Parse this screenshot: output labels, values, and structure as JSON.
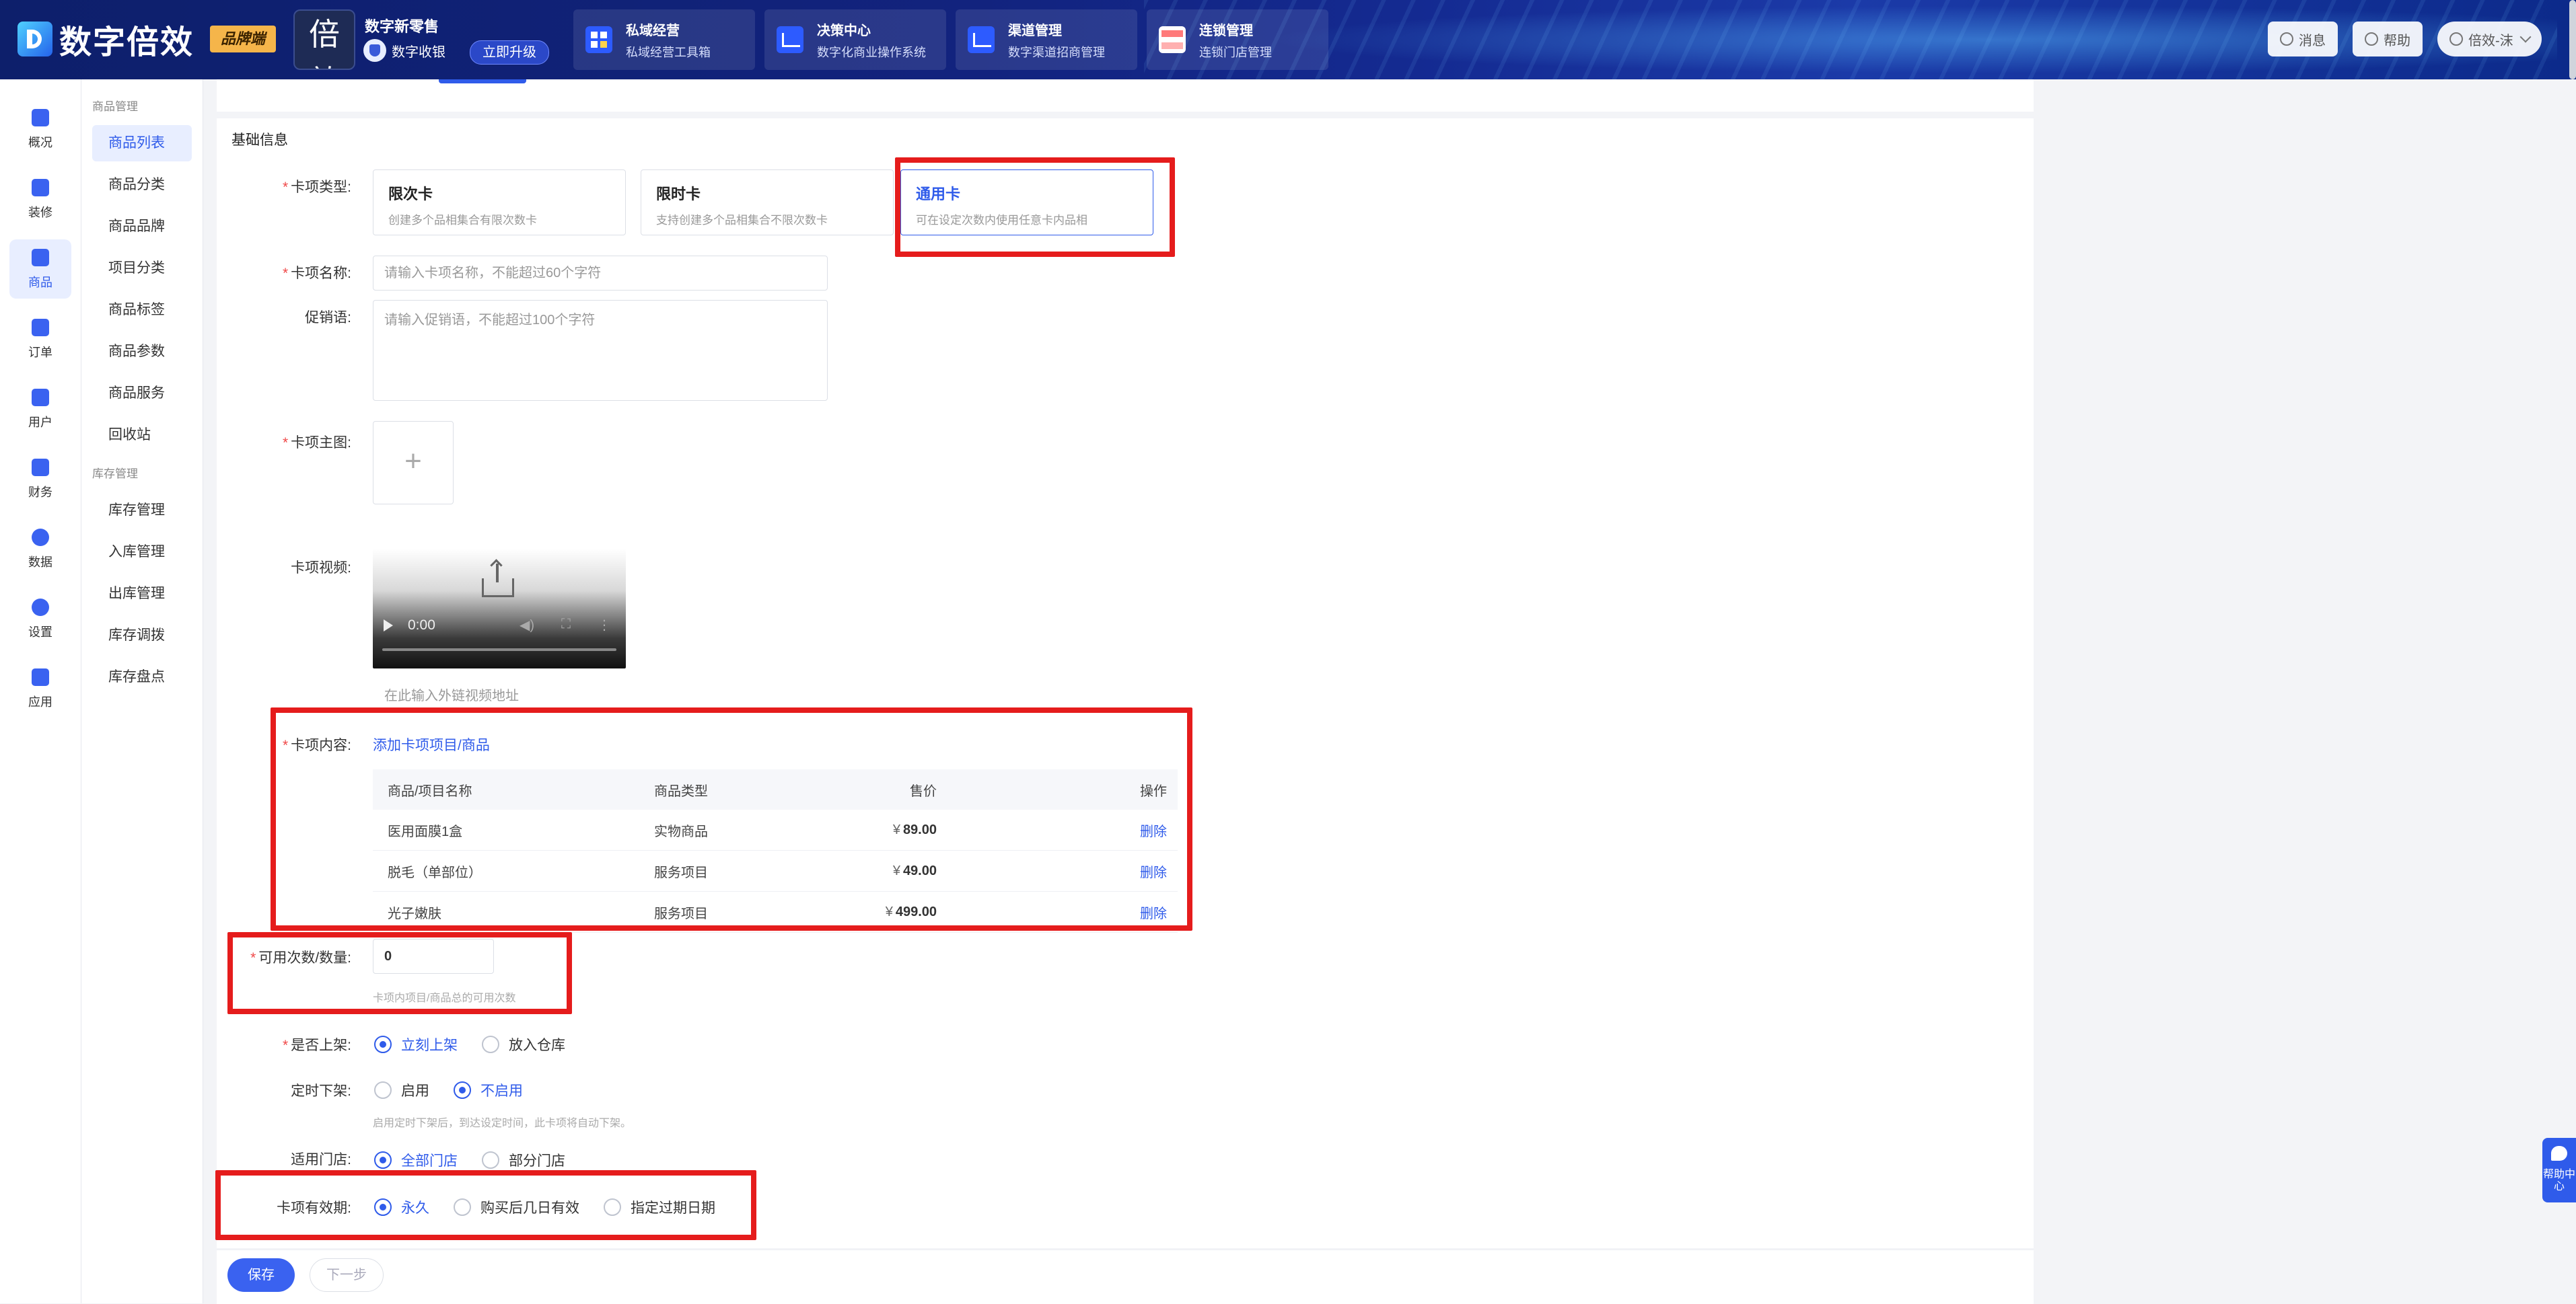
{
  "header": {
    "logo_text": "数字倍效",
    "brand_badge": "品牌端",
    "app_thumb_text": "倍效",
    "app_thumb_small": "行业",
    "retail_title": "数字新零售",
    "retail_sub": "数字收银",
    "upgrade": "立即升级",
    "nav": [
      {
        "title": "私域经营",
        "sub": "私域经营工具箱"
      },
      {
        "title": "决策中心",
        "sub": "数字化商业操作系统"
      },
      {
        "title": "渠道管理",
        "sub": "数字渠道招商管理"
      },
      {
        "title": "连锁管理",
        "sub": "连锁门店管理"
      }
    ],
    "messages": "消息",
    "help": "帮助",
    "user": "倍效-沫"
  },
  "rail": [
    "概况",
    "装修",
    "商品",
    "订单",
    "用户",
    "财务",
    "数据",
    "设置",
    "应用"
  ],
  "submenu": {
    "group1": "商品管理",
    "items1": [
      "商品列表",
      "商品分类",
      "商品品牌",
      "项目分类",
      "商品标签",
      "商品参数",
      "商品服务",
      "回收站"
    ],
    "group2": "库存管理",
    "items2": [
      "库存管理",
      "入库管理",
      "出库管理",
      "库存调拨",
      "库存盘点"
    ]
  },
  "form": {
    "section": "基础信息",
    "card_type_label": "卡项类型:",
    "card_types": [
      {
        "title": "限次卡",
        "desc": "创建多个品相集合有限次数卡"
      },
      {
        "title": "限时卡",
        "desc": "支持创建多个品相集合不限次数卡"
      },
      {
        "title": "通用卡",
        "desc": "可在设定次数内使用任意卡内品相"
      }
    ],
    "name_label": "卡项名称:",
    "name_placeholder": "请输入卡项名称，不能超过60个字符",
    "promo_label": "促销语:",
    "promo_placeholder": "请输入促销语，不能超过100个字符",
    "image_label": "卡项主图:",
    "video_label": "卡项视频:",
    "video_time": "0:00",
    "video_url_placeholder": "在此输入外链视频地址",
    "content_label": "卡项内容:",
    "add_link": "添加卡项项目/商品",
    "table_head": [
      "商品/项目名称",
      "商品类型",
      "售价",
      "操作"
    ],
    "rows": [
      {
        "name": "医用面膜1盒",
        "type": "实物商品",
        "price": "89.00",
        "op": "删除"
      },
      {
        "name": "脱毛（单部位）",
        "type": "服务项目",
        "price": "49.00",
        "op": "删除"
      },
      {
        "name": "光子嫩肤",
        "type": "服务项目",
        "price": "499.00",
        "op": "删除"
      }
    ],
    "yen": "¥",
    "count_label": "可用次数/数量:",
    "count_value": "0",
    "count_hint": "卡项内项目/商品总的可用次数",
    "onshelf_label": "是否上架:",
    "onshelf_opts": [
      "立刻上架",
      "放入仓库"
    ],
    "offshelf_label": "定时下架:",
    "offshelf_opts": [
      "启用",
      "不启用"
    ],
    "offshelf_hint": "启用定时下架后，到达设定时间，此卡项将自动下架。",
    "store_label": "适用门店:",
    "store_opts": [
      "全部门店",
      "部分门店"
    ],
    "validity_label": "卡项有效期:",
    "validity_opts": [
      "永久",
      "购买后几日有效",
      "指定过期日期"
    ]
  },
  "footer": {
    "save": "保存",
    "next": "下一步"
  },
  "help_float": "帮助中心",
  "colors": {
    "accent": "#2f5bea",
    "highlight": "#e51c1c",
    "required": "#f04848"
  }
}
